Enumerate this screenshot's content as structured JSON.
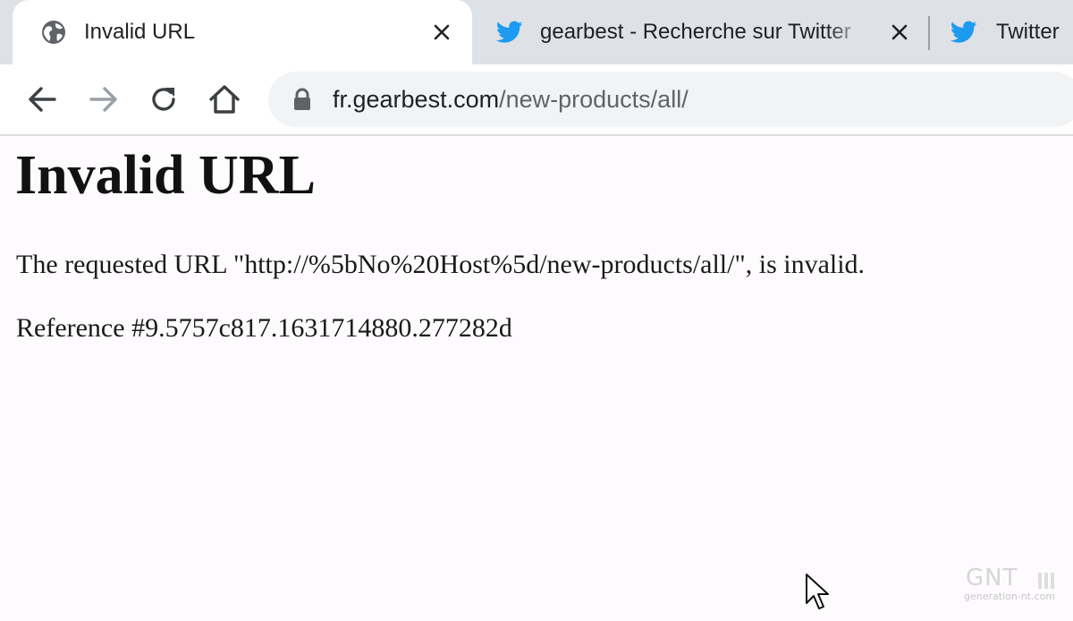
{
  "browser": {
    "tabs": [
      {
        "title": "Invalid URL",
        "icon": "globe-icon",
        "active": true
      },
      {
        "title": "gearbest - Recherche sur Twitter",
        "icon": "twitter-bird-icon",
        "active": false
      },
      {
        "title": "Twitter",
        "icon": "twitter-bird-icon",
        "active": false
      }
    ],
    "toolbar": {
      "back_icon": "back-arrow-icon",
      "forward_icon": "forward-arrow-icon",
      "reload_icon": "reload-icon",
      "home_icon": "home-icon"
    },
    "address_bar": {
      "lock_icon": "lock-icon",
      "host": "fr.gearbest.com",
      "path": "/new-products/all/"
    }
  },
  "page": {
    "heading": "Invalid URL",
    "message": "The requested URL \"http://%5bNo%20Host%5d/new-products/all/\", is invalid.",
    "reference": "Reference #9.5757c817.1631714880.277282d"
  },
  "watermark": {
    "logo": "GNT",
    "domain": "generation-nt.com"
  },
  "colors": {
    "tabstrip": "#dee1e6",
    "omnibox": "#f1f3f4",
    "twitter_blue": "#1d9bf0",
    "page_background": "#fdfbfd"
  }
}
